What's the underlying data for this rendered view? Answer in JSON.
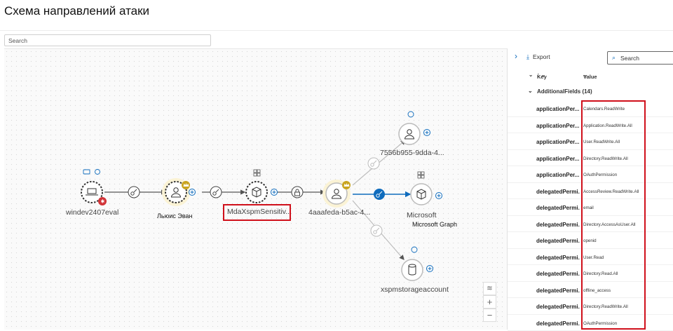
{
  "page": {
    "title": "Схема направлений атаки"
  },
  "search": {
    "placeholder": "Search"
  },
  "graph": {
    "nodes": {
      "windev": "windev2407eval",
      "lewis": "Льюис Эван",
      "mda": "MdaXspmSensitiv...",
      "app4": "4aaafeda-b5ac-4...",
      "sp7556": "7556b955-9dda-4...",
      "msgraph": "Microsoft",
      "msgraph_overlay": "Microsoft Graph",
      "storage": "xspmstorageaccount"
    },
    "colors": {
      "accent": "#0f6cbd",
      "highlight": "#d0101b",
      "crown": "#c9a41f",
      "alert": "#d13438"
    },
    "icons": [
      "laptop-icon",
      "user-icon",
      "cube-icon",
      "database-icon",
      "key-icon",
      "lock-icon",
      "crown-icon",
      "plus-icon",
      "bug-icon",
      "grid-icon",
      "layers-icon"
    ]
  },
  "zoom": {
    "layers": "layers-icon",
    "plus": "+",
    "minus": "−"
  },
  "panel": {
    "export_label": "Export",
    "search_label": "Search",
    "col_key": "Key",
    "col_value": "Value",
    "group_label": "AdditionalFields (14)",
    "rows": [
      {
        "key": "applicationPer...",
        "value": "Calendars.ReadWrite"
      },
      {
        "key": "applicationPer...",
        "value": "Application.ReadWrite.All"
      },
      {
        "key": "applicationPer...",
        "value": "User.ReadWrite.All"
      },
      {
        "key": "applicationPer...",
        "value": "Directory.ReadWrite.All"
      },
      {
        "key": "applicationPer...",
        "value": "OAuthPermission"
      },
      {
        "key": "delegatedPermi...",
        "value": "AccessReview.ReadWrite.All"
      },
      {
        "key": "delegatedPermi...",
        "value": "email"
      },
      {
        "key": "delegatedPermi...",
        "value": "Directory.AccessAsUser.All"
      },
      {
        "key": "delegatedPermi...",
        "value": "openid"
      },
      {
        "key": "delegatedPermi...",
        "value": "User.Read"
      },
      {
        "key": "delegatedPermi...",
        "value": "Directory.Read.All"
      },
      {
        "key": "delegatedPermi...",
        "value": "offline_access"
      },
      {
        "key": "delegatedPermi...",
        "value": "Directory.ReadWrite.All"
      },
      {
        "key": "delegatedPermi...",
        "value": "OAuthPermission"
      }
    ]
  }
}
